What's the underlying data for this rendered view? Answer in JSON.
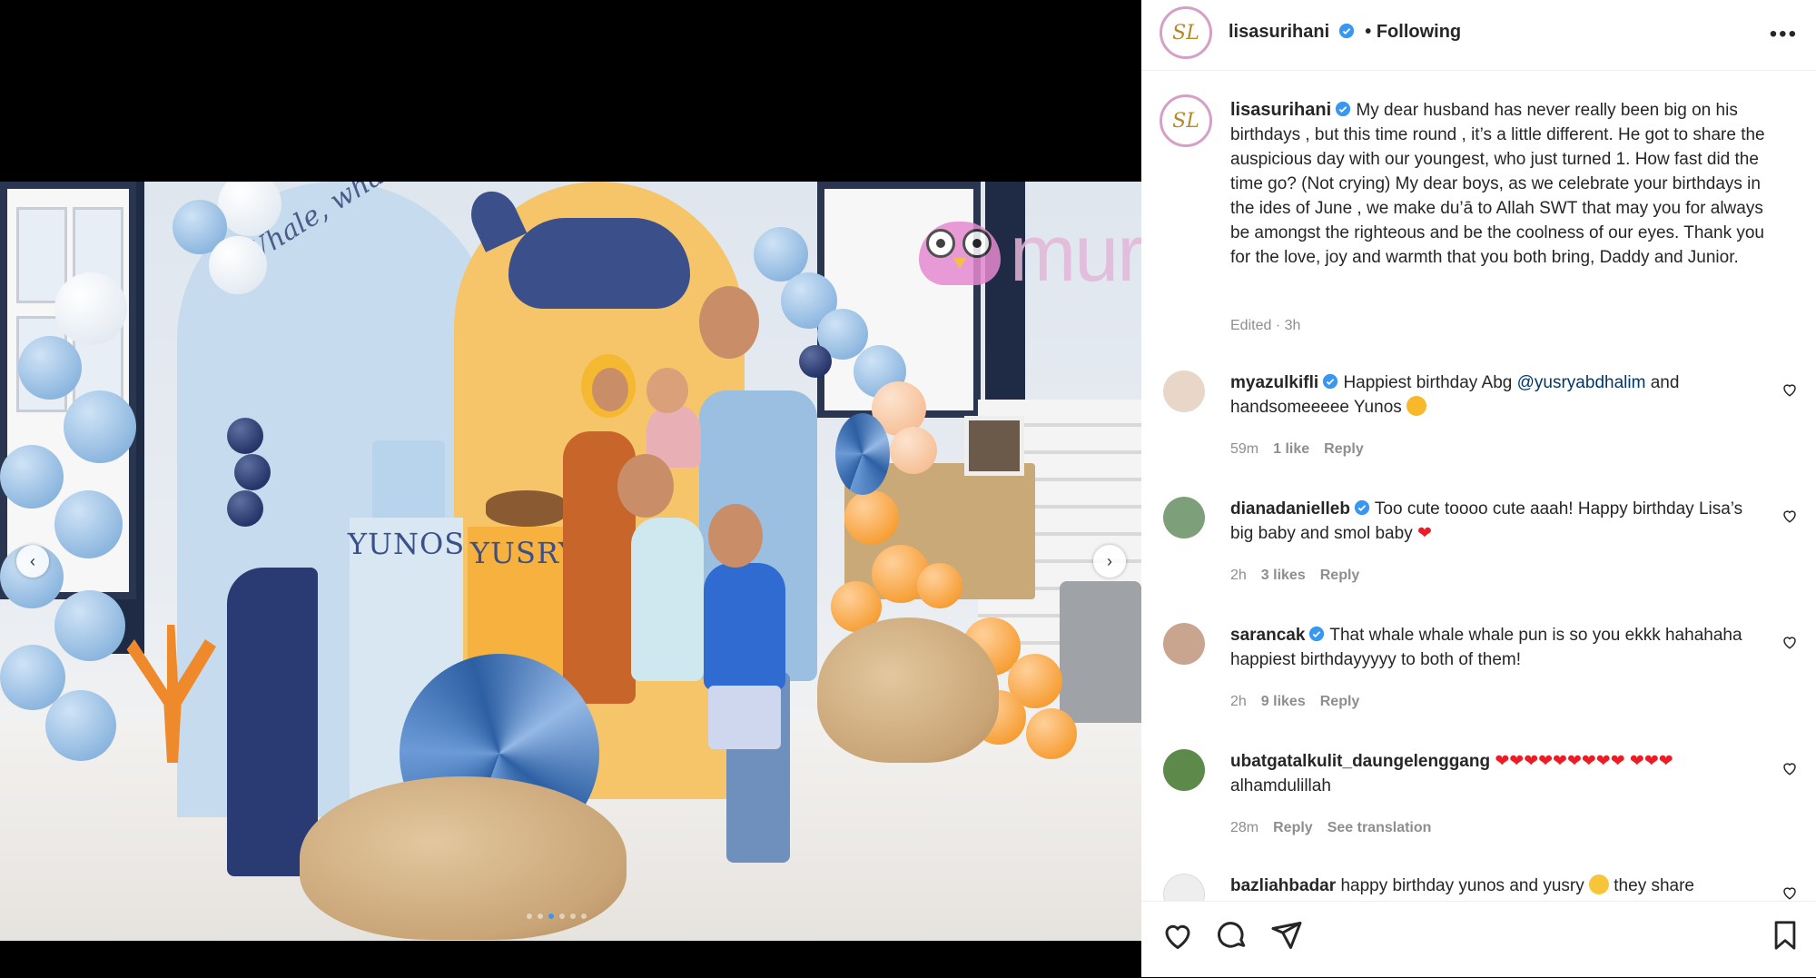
{
  "post": {
    "username": "lisasurihani",
    "follow_status": "• Following",
    "more_label": "•••",
    "avatar_initials": "SL"
  },
  "media": {
    "pedestal_left": "YUNOS",
    "pedestal_right": "YUSRY",
    "banner_text": "Whale, whale, whale... it's your birthday!",
    "watermark": "murai",
    "nav_prev": "‹",
    "nav_next": "›",
    "slide_count": 6,
    "active_slide": 3
  },
  "caption": {
    "username": "lisasurihani",
    "text": "My dear husband has never really been big on his birthdays , but this time round , it’s a little different. He got to share the auspicious day with our youngest, who just turned 1. How fast did the time go? (Not crying) My dear boys, as we celebrate your birthdays in the ides of June , we make du’ā to Allah SWT that may you for always be amongst the righteous and be the coolness of our eyes. Thank you for the love, joy and warmth that you both bring, Daddy and Junior.",
    "meta": "Edited · 3h"
  },
  "comments": [
    {
      "username": "myazulkifli",
      "verified": true,
      "text": "Happiest birthday Abg ",
      "mention": "@yusryabdhalim",
      "text_after": " and handsomeeeee Yunos",
      "emoji": "star-eyes-emoji",
      "time": "59m",
      "likes": "1 like",
      "reply": "Reply"
    },
    {
      "username": "dianadanielleb",
      "verified": true,
      "text": "Too cute toooo cute aaah! Happy birthday Lisa’s big baby and smol baby",
      "hearts": "❤",
      "time": "2h",
      "likes": "3 likes",
      "reply": "Reply"
    },
    {
      "username": "sarancak",
      "verified": true,
      "text": "That whale whale whale pun is so you ekkk hahahaha happiest birthdayyyyy to both of them!",
      "time": "2h",
      "likes": "9 likes",
      "reply": "Reply"
    },
    {
      "username": "ubatgatalkulit_daungelenggang",
      "verified": false,
      "hearts_line1": "❤❤❤❤❤❤❤❤❤",
      "hearts_line2": "❤❤❤",
      "text": "alhamdulillah",
      "time": "28m",
      "reply": "Reply",
      "see_translation": "See translation"
    },
    {
      "username": "bazliahbadar",
      "verified": false,
      "text": "happy birthday yunos and yusry ",
      "text_after": " they share",
      "emoji": "smiling-face-emoji"
    }
  ],
  "actions": {
    "like": "heart-icon",
    "comment": "comment-icon",
    "share": "share-icon",
    "save": "bookmark-icon"
  },
  "colors": {
    "verified": "#3897f0",
    "heart": "#ed1c24",
    "meta_gray": "#8e8e8e",
    "text": "#262626"
  }
}
